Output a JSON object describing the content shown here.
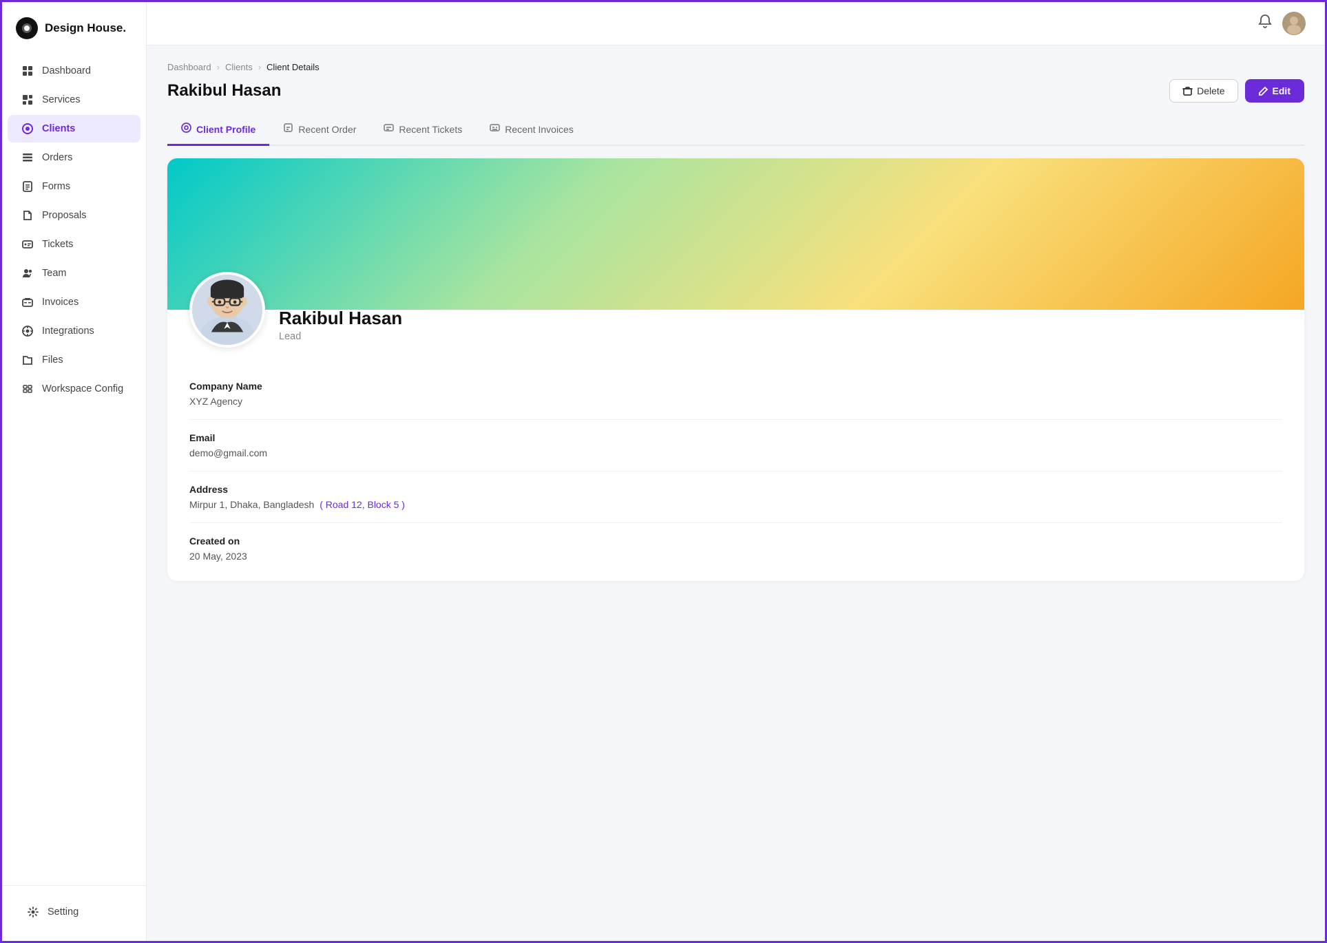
{
  "app": {
    "logo_text": "Design House.",
    "logo_icon": "⬤"
  },
  "sidebar": {
    "items": [
      {
        "id": "dashboard",
        "label": "Dashboard",
        "icon": "grid"
      },
      {
        "id": "services",
        "label": "Services",
        "icon": "tag"
      },
      {
        "id": "clients",
        "label": "Clients",
        "icon": "circle-dot",
        "active": true
      },
      {
        "id": "orders",
        "label": "Orders",
        "icon": "list"
      },
      {
        "id": "forms",
        "label": "Forms",
        "icon": "file-text"
      },
      {
        "id": "proposals",
        "label": "Proposals",
        "icon": "file"
      },
      {
        "id": "tickets",
        "label": "Tickets",
        "icon": "alert-circle"
      },
      {
        "id": "team",
        "label": "Team",
        "icon": "users"
      },
      {
        "id": "invoices",
        "label": "Invoices",
        "icon": "credit-card"
      },
      {
        "id": "integrations",
        "label": "Integrations",
        "icon": "settings"
      },
      {
        "id": "files",
        "label": "Files",
        "icon": "folder"
      },
      {
        "id": "workspace-config",
        "label": "Workspace Config",
        "icon": "sliders"
      }
    ],
    "bottom_item": {
      "id": "setting",
      "label": "Setting",
      "icon": "gear"
    }
  },
  "breadcrumb": {
    "items": [
      "Dashboard",
      "Clients",
      "Client Details"
    ]
  },
  "page": {
    "title": "Rakibul Hasan",
    "delete_label": "Delete",
    "edit_label": "Edit"
  },
  "tabs": [
    {
      "id": "client-profile",
      "label": "Client Profile",
      "active": true
    },
    {
      "id": "recent-order",
      "label": "Recent Order",
      "active": false
    },
    {
      "id": "recent-tickets",
      "label": "Recent Tickets",
      "active": false
    },
    {
      "id": "recent-invoices",
      "label": "Recent Invoices",
      "active": false
    }
  ],
  "profile": {
    "name": "Rakibul Hasan",
    "role": "Lead",
    "fields": [
      {
        "label": "Company Name",
        "value": "XYZ Agency",
        "extra": ""
      },
      {
        "label": "Email",
        "value": "demo@gmail.com",
        "extra": ""
      },
      {
        "label": "Address",
        "value": "Mirpur 1, Dhaka, Bangladesh",
        "extra": "( Road 12, Block 5 )"
      },
      {
        "label": "Created on",
        "value": "20 May, 2023",
        "extra": ""
      }
    ]
  },
  "colors": {
    "accent": "#6c2bd9",
    "active_bg": "#ede9ff"
  }
}
